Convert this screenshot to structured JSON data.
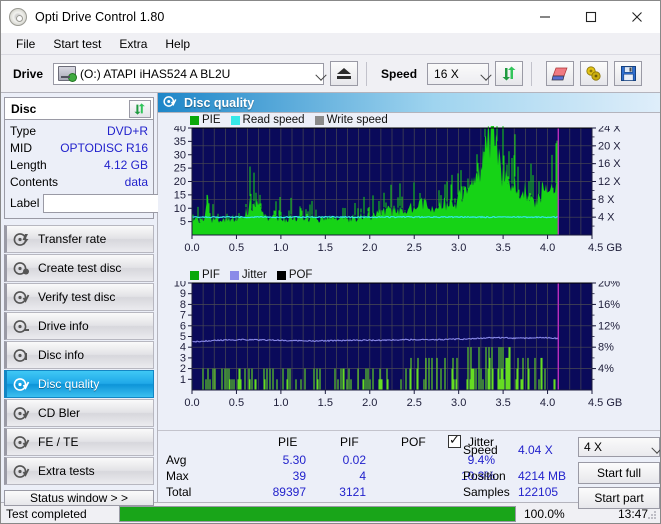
{
  "window": {
    "title": "Opti Drive Control 1.80",
    "icon": "disc-icon",
    "minimize": "–",
    "maximize": "□",
    "close": "✕"
  },
  "menu": {
    "items": [
      {
        "label": "File"
      },
      {
        "label": "Start test"
      },
      {
        "label": "Extra"
      },
      {
        "label": "Help"
      }
    ]
  },
  "toolbar": {
    "drive_label": "Drive",
    "drive_value": "(O:)  ATAPI iHAS524   A BL2U",
    "eject_title": "Eject",
    "speed_label": "Speed",
    "speed_value": "16 X",
    "refresh_title": "Refresh",
    "erase_title": "Erase disc",
    "settings_title": "Settings",
    "save_title": "Save"
  },
  "disc_panel": {
    "title": "Disc",
    "refresh_title": "Refresh disc info",
    "rows": [
      {
        "key": "Type",
        "value": "DVD+R"
      },
      {
        "key": "MID",
        "value": "OPTODISC R16"
      },
      {
        "key": "Length",
        "value": "4.12 GB"
      },
      {
        "key": "Contents",
        "value": "data"
      }
    ],
    "label_key": "Label",
    "label_value": "",
    "label_placeholder": ""
  },
  "nav": {
    "items": [
      {
        "label": "Transfer rate",
        "selected": false
      },
      {
        "label": "Create test disc",
        "selected": false
      },
      {
        "label": "Verify test disc",
        "selected": false
      },
      {
        "label": "Drive info",
        "selected": false
      },
      {
        "label": "Disc info",
        "selected": false
      },
      {
        "label": "Disc quality",
        "selected": true
      },
      {
        "label": "CD Bler",
        "selected": false
      },
      {
        "label": "FE / TE",
        "selected": false
      },
      {
        "label": "Extra tests",
        "selected": false
      }
    ],
    "status_window": "Status window > >"
  },
  "content": {
    "header_title": "Disc quality",
    "header_icon": "disc-quality-icon"
  },
  "stats": {
    "columns": [
      "PIE",
      "PIF",
      "POF",
      "Jitter"
    ],
    "jitter_checked": true,
    "rows": [
      {
        "label": "Avg",
        "pie": "5.30",
        "pif": "0.02",
        "pof": "",
        "jitter": "9.4%"
      },
      {
        "label": "Max",
        "pie": "39",
        "pif": "4",
        "pof": "",
        "jitter": "10.3%"
      },
      {
        "label": "Total",
        "pie": "89397",
        "pif": "3121",
        "pof": "",
        "jitter": ""
      }
    ],
    "speed_label": "Speed",
    "speed_value": "4.04 X",
    "position_label": "Position",
    "position_value": "4214 MB",
    "samples_label": "Samples",
    "samples_value": "122105",
    "read_speed_select": "4 X",
    "start_full": "Start full",
    "start_part": "Start part"
  },
  "statusbar": {
    "message": "Test completed",
    "progress_pct": 100.0,
    "progress_text": "100.0%",
    "elapsed": "13:47"
  },
  "colors": {
    "plot_bg": "#0a0a5a",
    "pie_green": "#16d316",
    "read_speed_cyan": "#35e8e8",
    "write_speed_gray": "#8a8a8a",
    "jitter_blue": "#8a8ae8",
    "pof_black": "#000000",
    "pif_green": "#66dd22",
    "marker_magenta": "#d028d0",
    "accent": "#1fa8e8",
    "value_blue": "#2222cc",
    "progress_green": "#19a519"
  },
  "chart_data": [
    {
      "type": "area",
      "id": "pie-chart",
      "title": "",
      "legend": [
        {
          "label": "PIE",
          "color": "#0aa80a"
        },
        {
          "label": "Read speed",
          "color": "#35e8e8"
        },
        {
          "label": "Write speed",
          "color": "#8a8a8a"
        }
      ],
      "legend_position": "top-left",
      "xlabel": "GB",
      "ylabel": "PIE",
      "y2label": "X",
      "xlim": [
        0,
        4.5
      ],
      "ylim": [
        0,
        40
      ],
      "y2lim": [
        0,
        24
      ],
      "xticks": [
        0.0,
        0.5,
        1.0,
        1.5,
        2.0,
        2.5,
        3.0,
        3.5,
        4.0,
        4.5
      ],
      "xticklabels": [
        "0.0",
        "0.5",
        "1.0",
        "1.5",
        "2.0",
        "2.5",
        "3.0",
        "3.5",
        "4.0",
        "4.5 GB"
      ],
      "yticks": [
        5,
        10,
        15,
        20,
        25,
        30,
        35,
        40
      ],
      "y2ticks": [
        4,
        8,
        12,
        16,
        20,
        24
      ],
      "y2ticklabels": [
        "4 X",
        "8 X",
        "12 X",
        "16 X",
        "20 X",
        "24 X"
      ],
      "grid": true,
      "data_end_x": 4.12,
      "marker_x": 4.12,
      "series": [
        {
          "name": "PIE",
          "color": "#16d316",
          "x": [
            0.0,
            0.05,
            0.1,
            0.15,
            0.17,
            0.2,
            0.25,
            0.3,
            0.35,
            0.4,
            0.45,
            0.5,
            0.55,
            0.6,
            0.63,
            0.66,
            0.7,
            0.73,
            0.76,
            0.8,
            0.85,
            0.9,
            0.95,
            1.0,
            1.05,
            1.1,
            1.15,
            1.2,
            1.25,
            1.3,
            1.35,
            1.4,
            1.45,
            1.5,
            1.55,
            1.6,
            1.65,
            1.7,
            1.75,
            1.8,
            1.85,
            1.9,
            1.95,
            2.0,
            2.05,
            2.1,
            2.15,
            2.2,
            2.25,
            2.3,
            2.35,
            2.4,
            2.45,
            2.5,
            2.55,
            2.6,
            2.65,
            2.7,
            2.75,
            2.8,
            2.85,
            2.9,
            2.95,
            3.0,
            3.05,
            3.1,
            3.15,
            3.2,
            3.25,
            3.3,
            3.35,
            3.38,
            3.42,
            3.46,
            3.5,
            3.55,
            3.6,
            3.65,
            3.7,
            3.75,
            3.8,
            3.85,
            3.9,
            3.95,
            4.0,
            4.05,
            4.1,
            4.12
          ],
          "y": [
            6,
            5,
            5,
            6,
            15,
            5,
            6,
            5,
            6,
            5,
            6,
            6,
            7,
            8,
            9,
            12,
            10,
            11,
            9,
            7,
            6,
            6,
            6,
            6,
            6,
            6,
            6,
            6,
            6,
            6,
            6,
            5,
            6,
            6,
            6,
            6,
            6,
            6,
            6,
            6,
            6,
            7,
            7,
            7,
            7,
            8,
            8,
            9,
            8,
            8,
            9,
            9,
            10,
            9,
            10,
            11,
            10,
            11,
            10,
            10,
            11,
            12,
            12,
            13,
            14,
            15,
            17,
            20,
            23,
            30,
            36,
            39,
            33,
            26,
            21,
            24,
            19,
            16,
            15,
            16,
            13,
            11,
            12,
            17,
            16,
            18,
            21,
            18
          ]
        },
        {
          "name": "Read speed",
          "color": "#35e8e8",
          "x": [
            0.0,
            0.3,
            0.6,
            0.9,
            1.2,
            1.5,
            1.8,
            2.1,
            2.4,
            2.7,
            3.0,
            3.3,
            3.6,
            3.9,
            4.12
          ],
          "y": [
            4.0,
            4.04,
            4.04,
            4.05,
            4.04,
            4.04,
            4.05,
            4.04,
            4.04,
            4.05,
            4.04,
            4.04,
            4.05,
            4.04,
            4.04
          ],
          "axis": "y2"
        }
      ]
    },
    {
      "type": "bar",
      "id": "pif-chart",
      "title": "",
      "legend": [
        {
          "label": "PIF",
          "color": "#0aa80a"
        },
        {
          "label": "Jitter",
          "color": "#8a8ae8"
        },
        {
          "label": "POF",
          "color": "#000000"
        }
      ],
      "legend_position": "top-left",
      "xlabel": "GB",
      "ylabel": "PIF",
      "y2label": "%",
      "xlim": [
        0,
        4.5
      ],
      "ylim": [
        0,
        10
      ],
      "y2lim": [
        0,
        20
      ],
      "xticks": [
        0.0,
        0.5,
        1.0,
        1.5,
        2.0,
        2.5,
        3.0,
        3.5,
        4.0,
        4.5
      ],
      "xticklabels": [
        "0.0",
        "0.5",
        "1.0",
        "1.5",
        "2.0",
        "2.5",
        "3.0",
        "3.5",
        "4.0",
        "4.5 GB"
      ],
      "yticks": [
        1,
        2,
        3,
        4,
        5,
        6,
        7,
        8,
        9,
        10
      ],
      "y2ticks": [
        4,
        8,
        12,
        16,
        20
      ],
      "y2ticklabels": [
        "4%",
        "8%",
        "12%",
        "16%",
        "20%"
      ],
      "grid": true,
      "data_end_x": 4.12,
      "marker_x": 4.12,
      "series": [
        {
          "name": "PIF",
          "color": "#66dd22",
          "note": "sparse spikes, height 1-2 across most of disc, rising to 3-4 around 3.2-3.5 GB"
        },
        {
          "name": "Jitter",
          "color": "#8a8ae8",
          "axis": "y2",
          "x": [
            0.0,
            0.3,
            0.6,
            0.9,
            1.2,
            1.5,
            1.8,
            2.1,
            2.4,
            2.7,
            3.0,
            3.2,
            3.4,
            3.6,
            3.8,
            4.0,
            4.12
          ],
          "y": [
            9.0,
            9.3,
            9.4,
            9.3,
            9.2,
            9.2,
            9.3,
            9.3,
            9.4,
            9.4,
            9.5,
            9.6,
            9.8,
            9.7,
            9.7,
            9.8,
            9.6
          ]
        }
      ]
    }
  ]
}
